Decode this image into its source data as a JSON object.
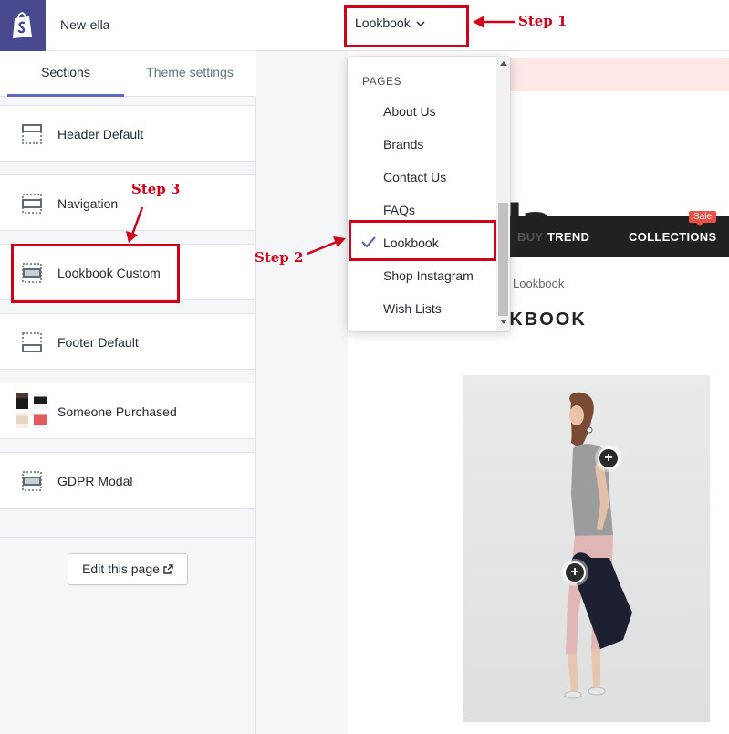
{
  "app": {
    "store_name": "New-ella",
    "logo_icon": "shopify-bag-icon",
    "brand_color": "#47498f"
  },
  "tabs": {
    "sections_label": "Sections",
    "theme_settings_label": "Theme settings",
    "active": "Sections",
    "accent": "#5c6ac4"
  },
  "sections": [
    {
      "label": "Header Default",
      "icon": "header-layout-icon"
    },
    {
      "label": "Navigation",
      "icon": "section-layout-icon"
    },
    {
      "label": "Lookbook Custom",
      "icon": "section-layout-icon"
    },
    {
      "label": "Footer Default",
      "icon": "footer-layout-icon"
    },
    {
      "label": "Someone Purchased",
      "icon": "product-thumbnails"
    },
    {
      "label": "GDPR Modal",
      "icon": "section-layout-icon"
    }
  ],
  "edit_page": {
    "label": "Edit this page",
    "icon": "external-link-icon"
  },
  "page_selector": {
    "value": "Lookbook",
    "icon": "chevron-down-icon"
  },
  "dropdown": {
    "heading": "PAGES",
    "items": [
      {
        "label": "About Us",
        "selected": false
      },
      {
        "label": "Brands",
        "selected": false
      },
      {
        "label": "Contact Us",
        "selected": false
      },
      {
        "label": "FAQs",
        "selected": false
      },
      {
        "label": "Lookbook",
        "selected": true
      },
      {
        "label": "Shop Instagram",
        "selected": false
      },
      {
        "label": "Wish Lists",
        "selected": false
      }
    ],
    "check_color": "#5c6ac4"
  },
  "storefront": {
    "logo": "ella",
    "nav": {
      "trend": "TREND",
      "collections": "COLLECTIONS",
      "sale_badge": "Sale",
      "partial_item": "BUY"
    },
    "breadcrumb_current": "Lookbook",
    "heading": "LOOKBOOK",
    "hotspot_symbol": "+",
    "promo_color": "#fde7e7",
    "nav_color": "#212121",
    "badge_color": "#e95144"
  },
  "annotations": {
    "step1": "Step 1",
    "step2": "Step 2",
    "step3": "Step 3",
    "color": "#d0021b"
  }
}
